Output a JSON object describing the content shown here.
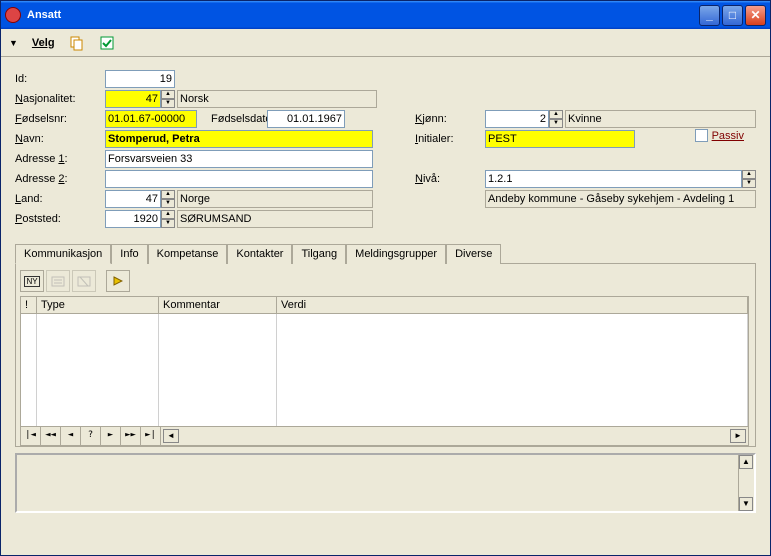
{
  "window": {
    "title": "Ansatt"
  },
  "toolbar": {
    "menu_velg": "Velg"
  },
  "passiv": {
    "label": "Passiv",
    "checked": false
  },
  "labels": {
    "id": "Id:",
    "nasjonalitet": "Nasjonalitet:",
    "fodselsnr": "Fødselsnr:",
    "fodselsdato": "Fødselsdato:",
    "navn": "Navn:",
    "adresse1": "Adresse 1:",
    "adresse2": "Adresse 2:",
    "land": "Land:",
    "poststed": "Poststed:",
    "kjonn": "Kjønn:",
    "initialer": "Initialer:",
    "niva": "Nivå:"
  },
  "fields": {
    "id": "19",
    "nasjonalitet_code": "47",
    "nasjonalitet_text": "Norsk",
    "fodselsnr": "01.01.67-00000",
    "fodselsdato": "01.01.1967",
    "navn": "Stomperud, Petra",
    "adresse1": "Forsvarsveien 33",
    "adresse2": "",
    "land_code": "47",
    "land_text": "Norge",
    "post_code": "1920",
    "post_text": "SØRUMSAND",
    "kjonn_code": "2",
    "kjonn_text": "Kvinne",
    "initialer": "PEST",
    "niva": "1.2.1",
    "niva_path": "Andeby kommune - Gåseby sykehjem - Avdeling 1"
  },
  "tabs": [
    "Kommunikasjon",
    "Info",
    "Kompetanse",
    "Kontakter",
    "Tilgang",
    "Meldingsgrupper",
    "Diverse"
  ],
  "active_tab": 0,
  "grid": {
    "columns": [
      "!",
      "Type",
      "Kommentar",
      "Verdi"
    ],
    "rows": []
  },
  "nav": [
    "|◄",
    "◄◄",
    "◄",
    "?",
    "►",
    "►►",
    "►|"
  ]
}
